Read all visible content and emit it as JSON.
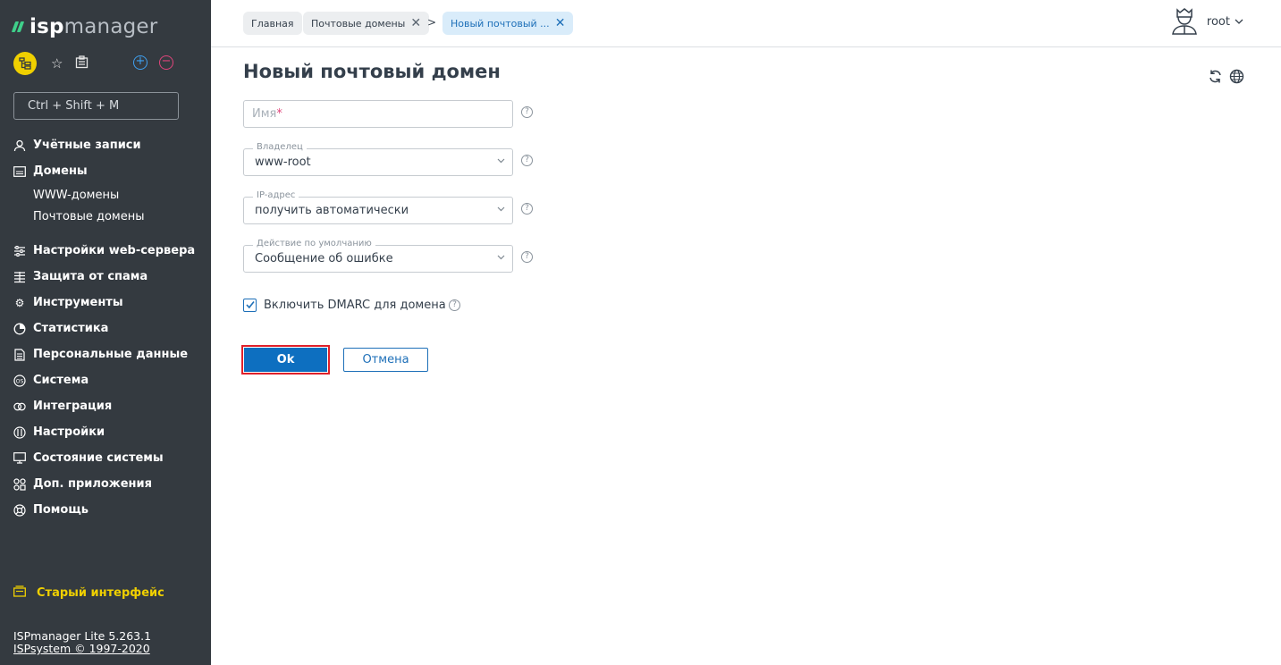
{
  "sidebar": {
    "logo": {
      "part1": "isp",
      "part2": "manager"
    },
    "search_placeholder": "Ctrl + Shift + M",
    "menu": [
      {
        "label": "Учётные записи",
        "icon": "users-icon"
      },
      {
        "label": "Домены",
        "icon": "domains-icon"
      }
    ],
    "submenu": [
      {
        "label": "WWW-домены"
      },
      {
        "label": "Почтовые домены"
      }
    ],
    "menu2": [
      {
        "label": "Настройки web-сервера",
        "icon": "sliders-icon"
      },
      {
        "label": "Защита от спама",
        "icon": "spam-filter-icon"
      },
      {
        "label": "Инструменты",
        "icon": "gear-icon"
      },
      {
        "label": "Статистика",
        "icon": "pie-chart-icon"
      },
      {
        "label": "Персональные данные",
        "icon": "personal-data-icon"
      },
      {
        "label": "Система",
        "icon": "os-icon"
      },
      {
        "label": "Интеграция",
        "icon": "integration-icon"
      },
      {
        "label": "Настройки",
        "icon": "settings-icon"
      },
      {
        "label": "Состояние системы",
        "icon": "monitor-icon"
      },
      {
        "label": "Доп. приложения",
        "icon": "apps-icon"
      },
      {
        "label": "Помощь",
        "icon": "help-lifebuoy-icon"
      }
    ],
    "old_ui": "Старый интерфейс",
    "version": "ISPmanager Lite 5.263.1",
    "copyright": "ISPsystem © 1997-2020"
  },
  "header": {
    "breadcrumbs": [
      {
        "label": "Главная"
      },
      {
        "label": "Почтовые домены"
      },
      {
        "label": "Новый почтовый ..."
      }
    ],
    "separator": ">",
    "user": "root"
  },
  "form": {
    "title": "Новый почтовый домен",
    "name_placeholder": "Имя",
    "required_mark": "*",
    "owner": {
      "label": "Владелец",
      "value": "www-root"
    },
    "ip": {
      "label": "IP-адрес",
      "value": "получить автоматически"
    },
    "default_action": {
      "label": "Действие по умолчанию",
      "value": "Сообщение об ошибке"
    },
    "dmarc": {
      "label": "Включить DMARC для домена",
      "checked": true
    },
    "ok_label": "Ok",
    "cancel_label": "Отмена",
    "help_glyph": "?"
  },
  "colors": {
    "sidebar_bg": "#343a40",
    "accent_yellow": "#f0d000",
    "primary_blue": "#0d6fc0",
    "highlight_red": "#e0202a"
  }
}
